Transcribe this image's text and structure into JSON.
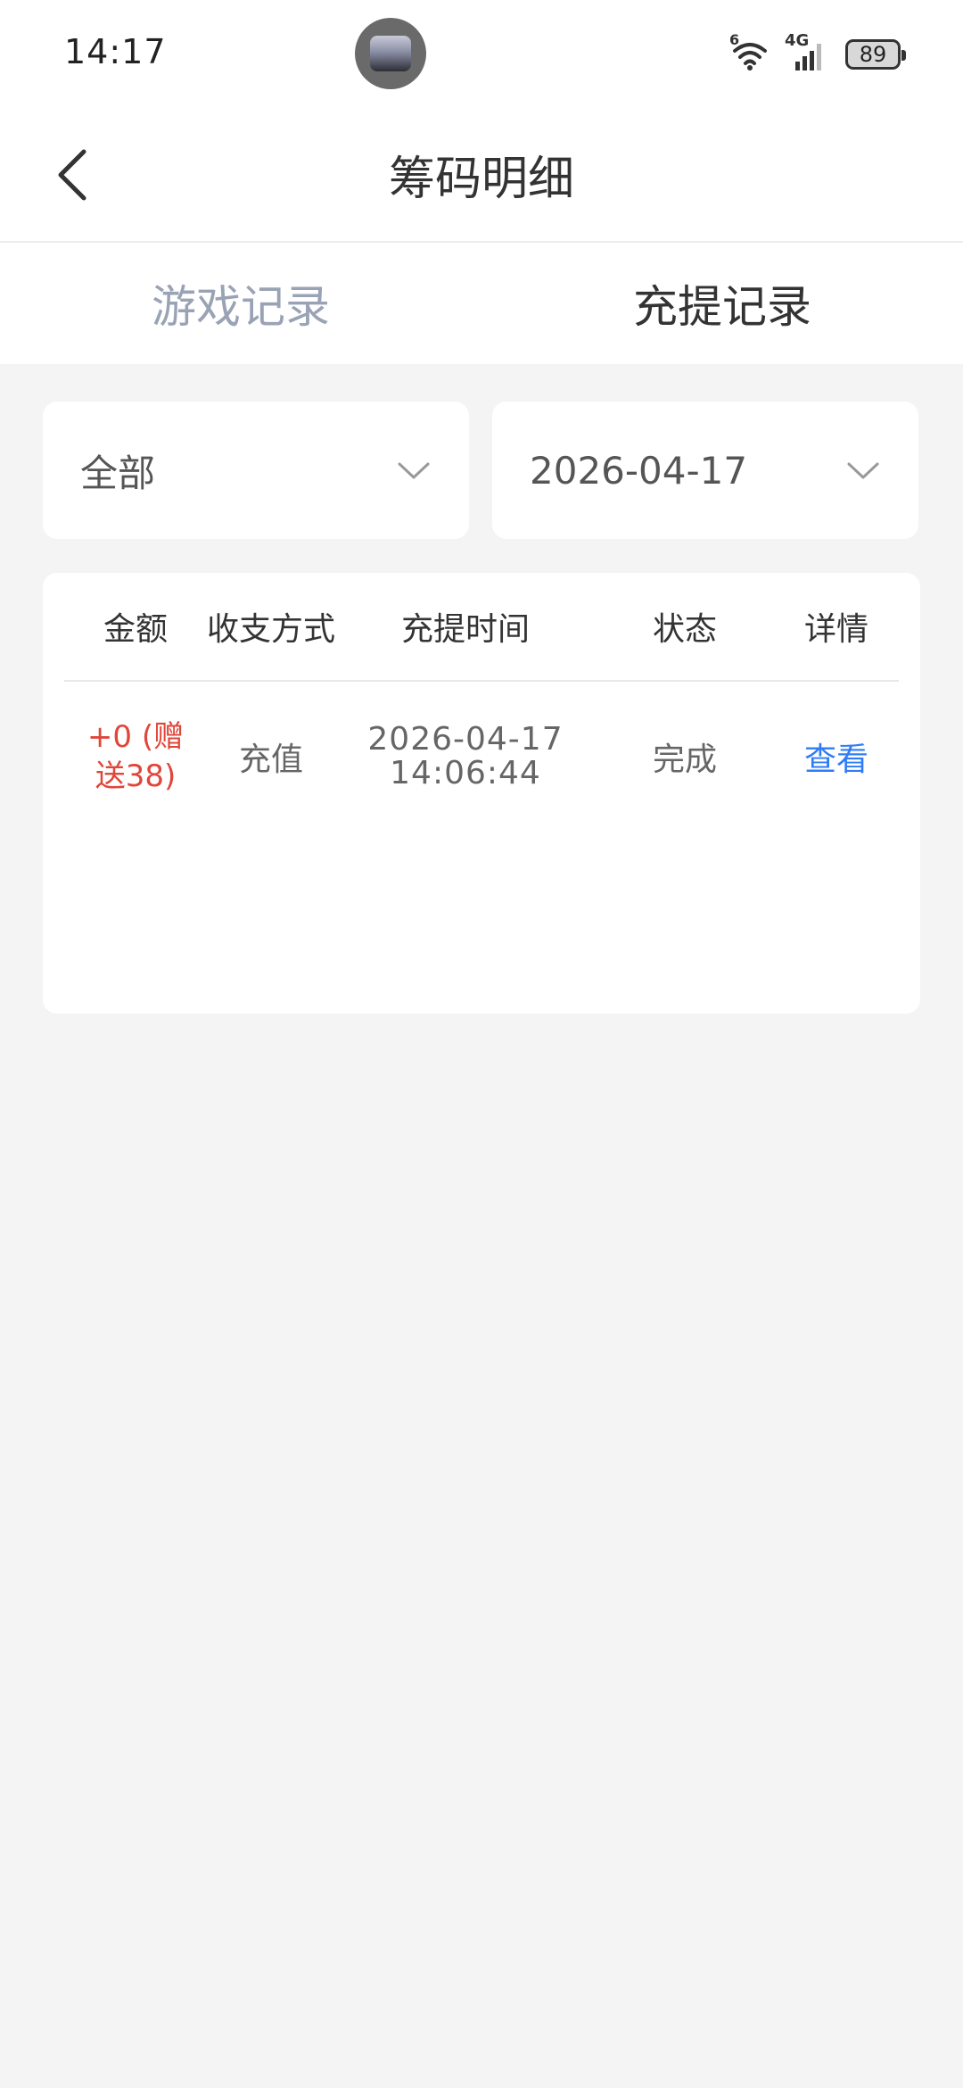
{
  "status_bar": {
    "time": "14:17",
    "network": "4G",
    "wifi_badge": "6",
    "battery": "89"
  },
  "header": {
    "title": "筹码明细"
  },
  "tabs": [
    {
      "label": "游戏记录",
      "active": false
    },
    {
      "label": "充提记录",
      "active": true
    }
  ],
  "filters": {
    "type": "全部",
    "date": "2026-04-17"
  },
  "table": {
    "columns": [
      "金额",
      "收支方式",
      "充提时间",
      "状态",
      "详情"
    ],
    "rows": [
      {
        "amount_line1": "+0 (赠",
        "amount_line2": "送38)",
        "method": "充值",
        "date": "2026-04-17",
        "time": "14:06:44",
        "status": "完成",
        "detail": "查看"
      }
    ]
  },
  "colors": {
    "amount": "#e0463a",
    "link": "#2f7df6",
    "tab_inactive": "#9aa3b5",
    "background": "#f4f4f4"
  }
}
